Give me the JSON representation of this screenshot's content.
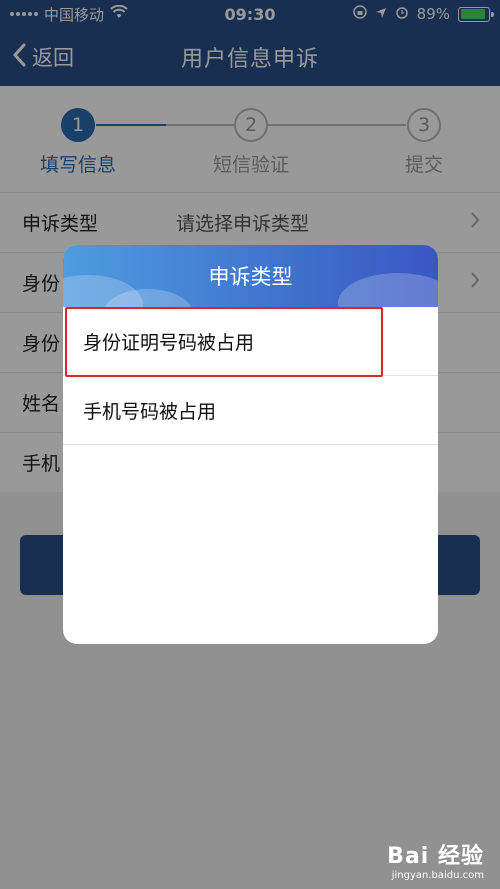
{
  "status": {
    "carrier": "中国移动",
    "time": "09:30",
    "battery": "89%",
    "battery_level": 0.89
  },
  "nav": {
    "back_label": "返回",
    "title": "用户信息申诉"
  },
  "steps": [
    {
      "num": "1",
      "label": "填写信息"
    },
    {
      "num": "2",
      "label": "短信验证"
    },
    {
      "num": "3",
      "label": "提交"
    }
  ],
  "form": {
    "rows": [
      {
        "label": "申诉类型",
        "value": "请选择申诉类型"
      },
      {
        "label": "身份"
      },
      {
        "label": "身份"
      },
      {
        "label": "姓名"
      },
      {
        "label": "手机"
      }
    ]
  },
  "modal": {
    "title": "申诉类型",
    "options": [
      "身份证明号码被占用",
      "手机号码被占用"
    ]
  },
  "watermark": {
    "brand": "Bai 经验",
    "site": "jingyan.baidu.com"
  },
  "colors": {
    "nav": "#2b4f87",
    "accent": "#2b6cb0",
    "highlight": "#d9262c"
  }
}
